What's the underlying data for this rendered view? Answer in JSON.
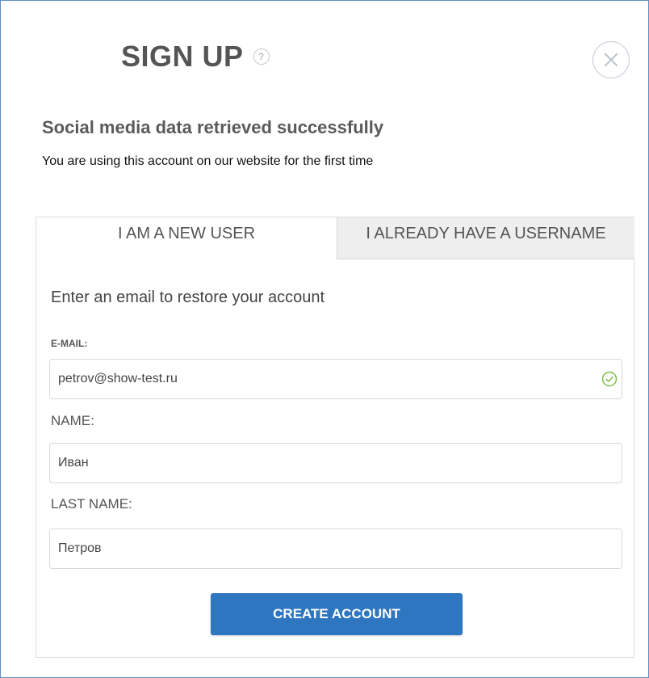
{
  "header": {
    "title": "SIGN UP",
    "help_glyph": "?"
  },
  "status": {
    "headline": "Social media data retrieved successfully",
    "description": "You are using this account on our website for the first time"
  },
  "tabs": [
    {
      "label": "I AM A NEW USER",
      "active": true
    },
    {
      "label": "I ALREADY HAVE A USERNAME",
      "active": false
    }
  ],
  "form": {
    "heading": "Enter an email to restore your account",
    "email_label": "E-MAIL:",
    "email_value": "petrov@show-test.ru",
    "name_label": "NAME:",
    "name_value": "Иван",
    "last_name_label": "LAST NAME:",
    "last_name_value": "Петров",
    "submit_label": "CREATE ACCOUNT"
  },
  "icons": {
    "help": "help-circle-icon",
    "close": "close-icon",
    "valid": "check-circle-icon"
  },
  "colors": {
    "accent": "#2e76bf",
    "valid": "#7ac143",
    "border": "#5b8ec4"
  }
}
